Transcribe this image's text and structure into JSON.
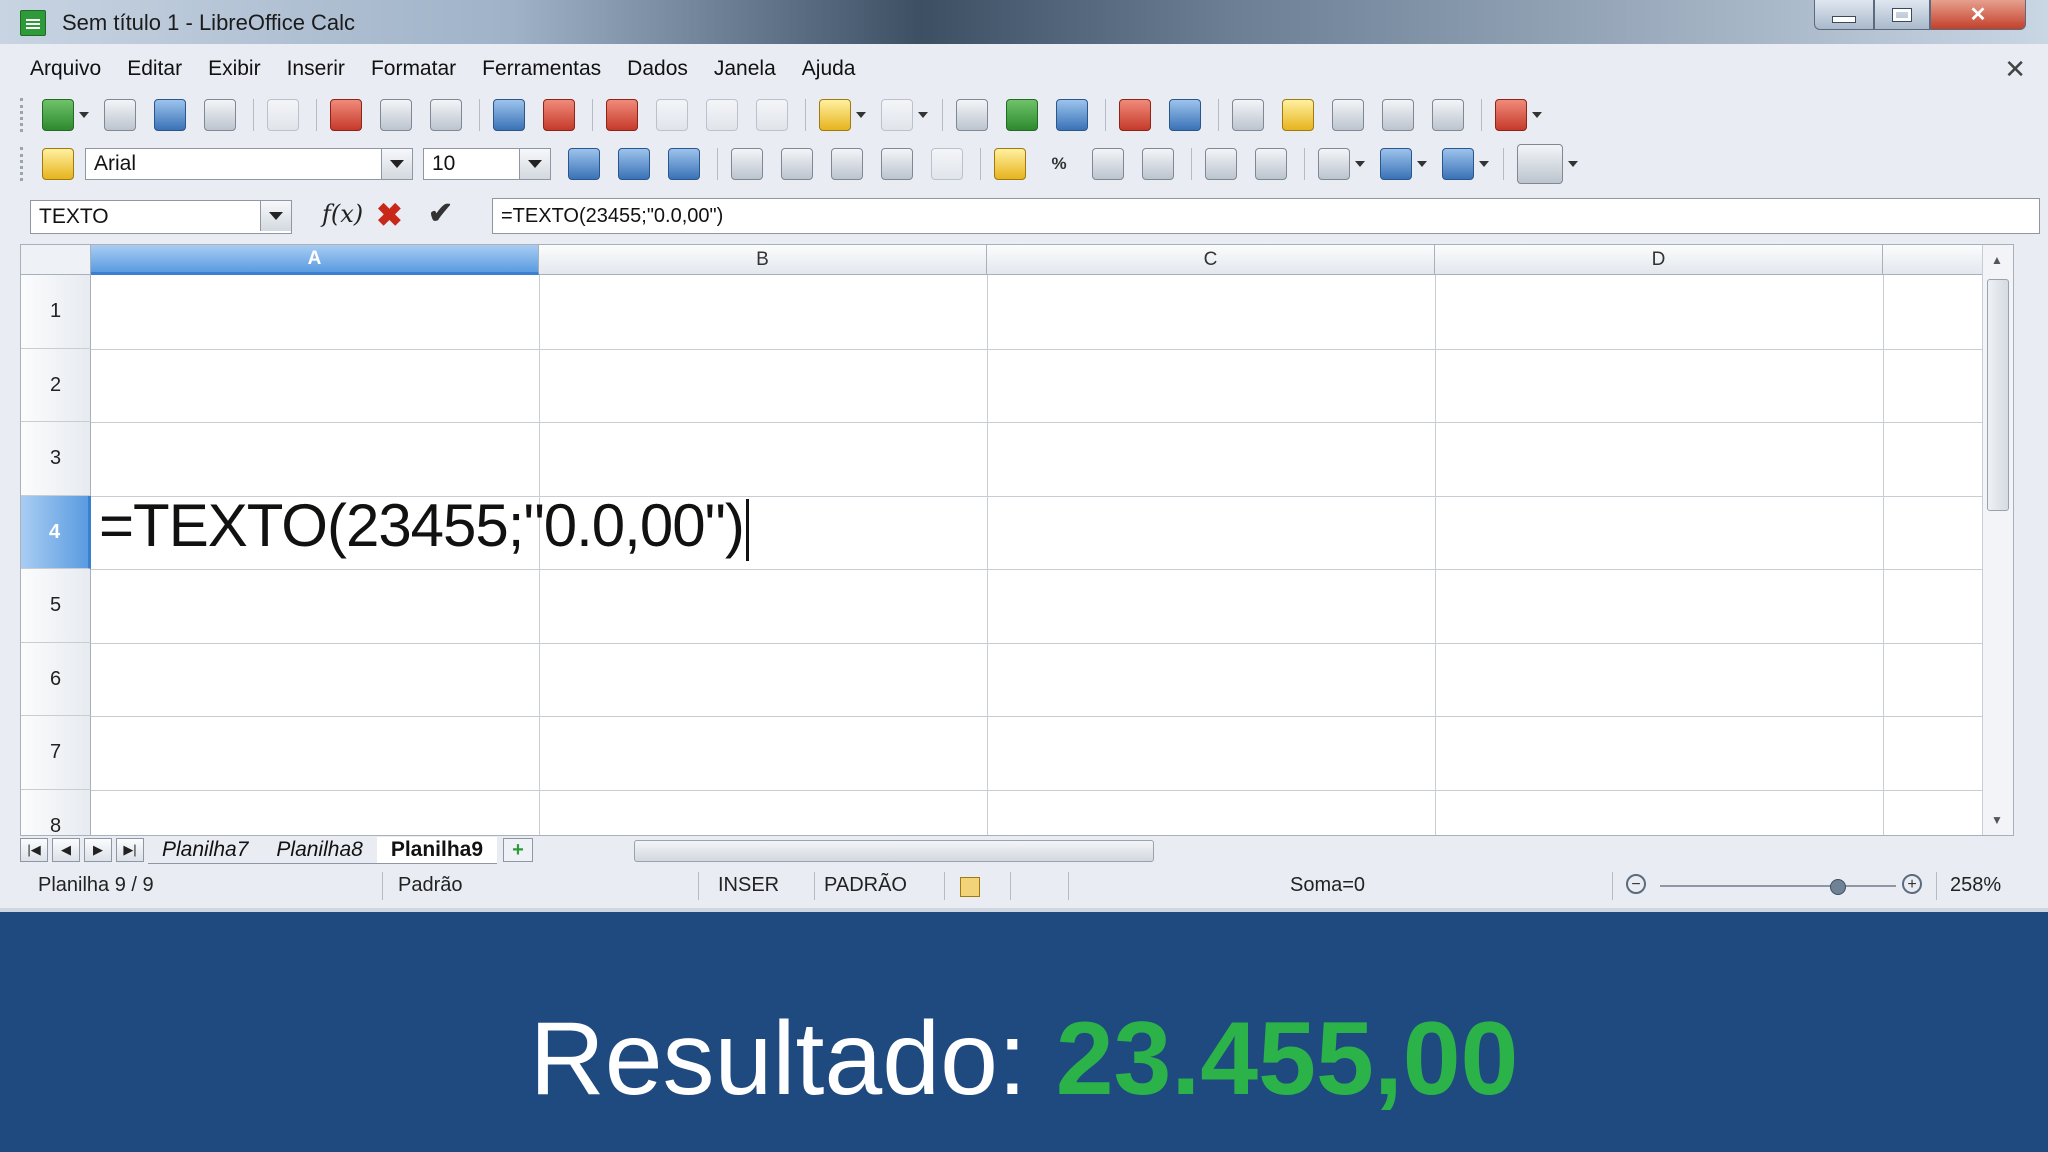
{
  "window": {
    "title": "Sem título 1 - LibreOffice Calc",
    "controls": {
      "minimize": "–",
      "maximize": "□",
      "close": "✕"
    }
  },
  "menu": {
    "items": [
      "Arquivo",
      "Editar",
      "Exibir",
      "Inserir",
      "Formatar",
      "Ferramentas",
      "Dados",
      "Janela",
      "Ajuda"
    ],
    "close_glyph": "✕"
  },
  "toolbar2": {
    "font_name": "Arial",
    "font_size": "10",
    "percent": "%"
  },
  "formula_bar": {
    "name_box": "TEXTO",
    "fx": "f(x)",
    "cancel_glyph": "✖",
    "accept_glyph": "✔",
    "input": "=TEXTO(23455;\"0.0,00\")"
  },
  "grid": {
    "columns": [
      "A",
      "B",
      "C",
      "D"
    ],
    "selected_column": "A",
    "rows": [
      "1",
      "2",
      "3",
      "4",
      "5",
      "6",
      "7",
      "8"
    ],
    "selected_row": "4",
    "active_cell_text": "=TEXTO(23455;\"0.0,00\")"
  },
  "sheet_tabs": {
    "nav": [
      "|◀",
      "◀",
      "▶",
      "▶|"
    ],
    "tabs": [
      "Planilha7",
      "Planilha8",
      "Planilha9"
    ],
    "active": "Planilha9",
    "add_glyph": "+"
  },
  "status_bar": {
    "sheet": "Planilha 9 / 9",
    "style": "Padrão",
    "insert_mode": "INSER",
    "selection_mode": "PADRÃO",
    "sum": "Soma=0",
    "zoom_minus": "−",
    "zoom_plus": "+",
    "zoom": "258%"
  },
  "banner": {
    "label": "Resultado:",
    "value": "23.455,00"
  },
  "colors": {
    "banner_bg": "#1f4a7f",
    "result_value": "#2bb34a",
    "selection_header": "#5a9be0"
  }
}
